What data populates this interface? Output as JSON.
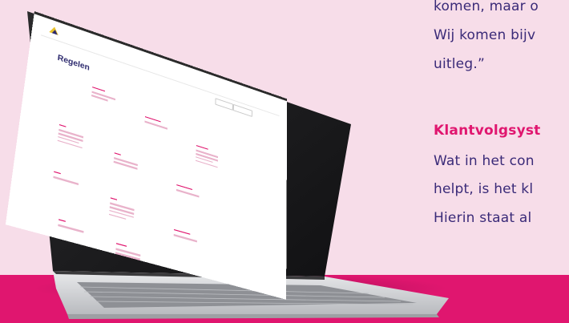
{
  "article": {
    "lines": [
      "komen, maar o",
      "Wij komen bijv",
      "uitleg.”"
    ],
    "heading": "Klantvolgsyst",
    "body_lines": [
      "Wat in het con",
      "helpt, is het kl",
      "Hierin staat al"
    ]
  },
  "colors": {
    "background": "#f7dde9",
    "accent_magenta": "#e0166f",
    "text_purple": "#3a2a78"
  },
  "screen": {
    "title": "Regelen"
  }
}
